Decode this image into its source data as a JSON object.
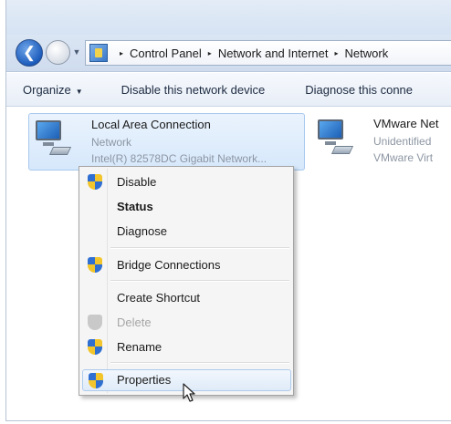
{
  "address": {
    "history_icon": "chevron-down-icon",
    "crumbs": [
      "Control Panel",
      "Network and Internet",
      "Network"
    ],
    "crumb_separator": "▸"
  },
  "toolbar": {
    "organize_label": "Organize",
    "disable_label": "Disable this network device",
    "diagnose_label": "Diagnose this conne"
  },
  "items": [
    {
      "name": "Local Area Connection",
      "status": "Network",
      "device": "Intel(R) 82578DC Gigabit Network...",
      "selected": true
    },
    {
      "name": "VMware Net",
      "status": "Unidentified",
      "device": "VMware Virt"
    }
  ],
  "context_menu": {
    "items": [
      {
        "label": "Disable",
        "icon": "shield-icon"
      },
      {
        "label": "Status",
        "bold": true
      },
      {
        "label": "Diagnose"
      },
      {
        "label": "Bridge Connections",
        "icon": "shield-icon"
      },
      {
        "label": "Create Shortcut"
      },
      {
        "label": "Delete",
        "icon": "shield-icon",
        "disabled": true
      },
      {
        "label": "Rename",
        "icon": "shield-icon"
      },
      {
        "label": "Properties",
        "icon": "shield-icon",
        "highlighted": true
      }
    ]
  },
  "colors": {
    "selection_fill": "#d6e8fb",
    "selection_border": "#a8c9ee",
    "shield_blue": "#2f6fd1",
    "shield_yellow": "#f2c52c"
  }
}
